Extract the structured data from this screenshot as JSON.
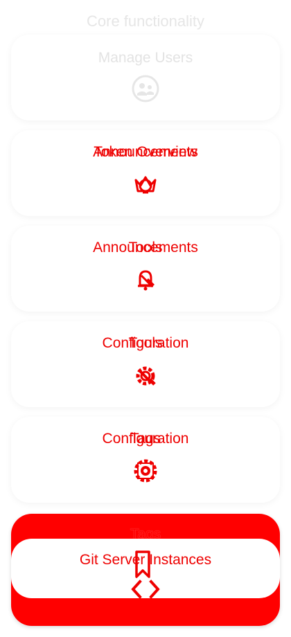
{
  "section": {
    "title": "Core functionality"
  },
  "cards": {
    "manage_users": {
      "label": "Manage Users",
      "icon": "manage-users-icon"
    },
    "token_overview": {
      "label_a": "Token Overview",
      "label_b": "Announcements",
      "icon": "crown-icon"
    },
    "announcements": {
      "label_a": "Announcements",
      "label_b": "Tools",
      "icon": "bell-icon"
    },
    "configuration_tools": {
      "label_a": "Configuration",
      "label_b": "Tools",
      "icon": "gear-wrench-icon"
    },
    "configuration_tags": {
      "label_a": "Configuration",
      "label_b": "Tags",
      "icon": "gear-icon"
    },
    "tags": {
      "label": "Tags",
      "icon": "bookmark-icon"
    },
    "git_server_instances": {
      "label": "Git Server Instances",
      "icon": "code-icon"
    }
  },
  "colors": {
    "accent": "#ee0000",
    "red_card": "#ff0000",
    "faded_text": "#e3e3e3"
  }
}
